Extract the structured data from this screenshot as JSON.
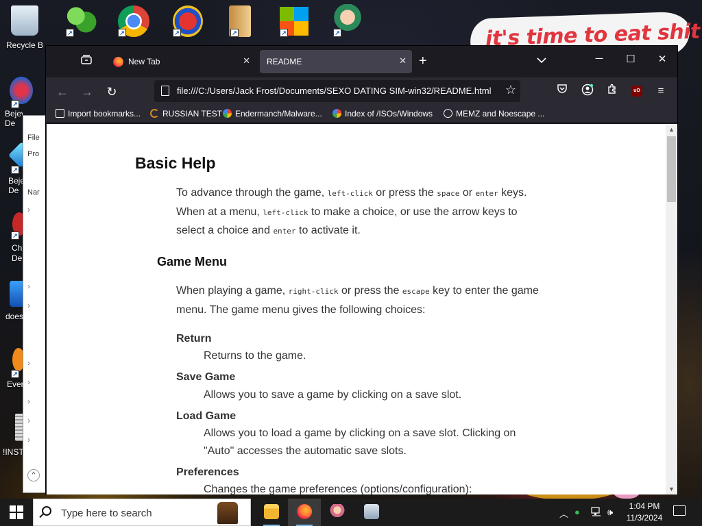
{
  "desktop": {
    "icons": [
      {
        "label": "Recycle B",
        "name": "recycle-bin-icon"
      },
      {
        "label": "Bejev De",
        "name": "bejeweled-2-icon"
      },
      {
        "label": "Beje De",
        "name": "bejeweled-icon"
      },
      {
        "label": "Ch De",
        "name": "chrome-deluxe-icon"
      },
      {
        "label": "does",
        "name": "does-icon"
      },
      {
        "label": "Ever",
        "name": "ever-icon"
      },
      {
        "label": "!INSTA",
        "name": "installer-icon"
      }
    ],
    "top_icons": [
      {
        "name": "messenger-icon"
      },
      {
        "name": "chrome-icon"
      },
      {
        "name": "p-app-icon"
      },
      {
        "name": "door-app-icon"
      },
      {
        "name": "windows-logo-icon"
      },
      {
        "name": "anime-character-icon"
      }
    ],
    "wallpaper_text": "it's time to eat shit"
  },
  "explorer": {
    "labels": [
      "File",
      "Pro",
      "Nar"
    ]
  },
  "browser": {
    "tabs": [
      {
        "label": "New Tab",
        "active": false
      },
      {
        "label": "README",
        "active": true
      }
    ],
    "url": "file:///C:/Users/Jack Frost/Documents/SEXO DATING SIM-win32/README.html",
    "bookmarks": [
      {
        "label": "Import bookmarks...",
        "color": "#fbfbfe"
      },
      {
        "label": "RUSSIAN TEST",
        "color": "#d08a2a"
      },
      {
        "label": "Endermanch/Malware...",
        "color": "#ffffff"
      },
      {
        "label": "Index of /ISOs/Windows",
        "color": "#ffffff"
      },
      {
        "label": "MEMZ and Noescape ...",
        "color": "#fbfbfe"
      }
    ]
  },
  "doc": {
    "h1": "Basic Help",
    "p1": {
      "a": "To advance through the game,",
      "c1": "left-click",
      "b": "or press the",
      "c2": "space",
      "d": "or",
      "c3": "enter",
      "e": "keys. When at a menu,",
      "c4": "left-click",
      "f": "to make a choice, or use the arrow keys to select a choice and",
      "c5": "enter",
      "g": "to activate it."
    },
    "h2": "Game Menu",
    "p2": {
      "a": "When playing a game,",
      "c1": "right-click",
      "b": "or press the",
      "c2": "escape",
      "c": "key to enter the game menu. The game menu gives the following choices:"
    },
    "items": [
      {
        "term": "Return",
        "desc": "Returns to the game."
      },
      {
        "term": "Save Game",
        "desc": "Allows you to save a game by clicking on a save slot."
      },
      {
        "term": "Load Game",
        "desc": "Allows you to load a game by clicking on a save slot. Clicking on \"Auto\" accesses the automatic save slots."
      },
      {
        "term": "Preferences",
        "desc": "Changes the game preferences (options/configuration):"
      }
    ]
  },
  "taskbar": {
    "search_placeholder": "Type here to search",
    "time": "1:04 PM",
    "date": "11/3/2024"
  },
  "colors": {
    "accent": "#76b9ed",
    "chrome_bg": "#1c1b22",
    "toolbar_bg": "#2b2a33",
    "active_tab": "#42414d"
  }
}
